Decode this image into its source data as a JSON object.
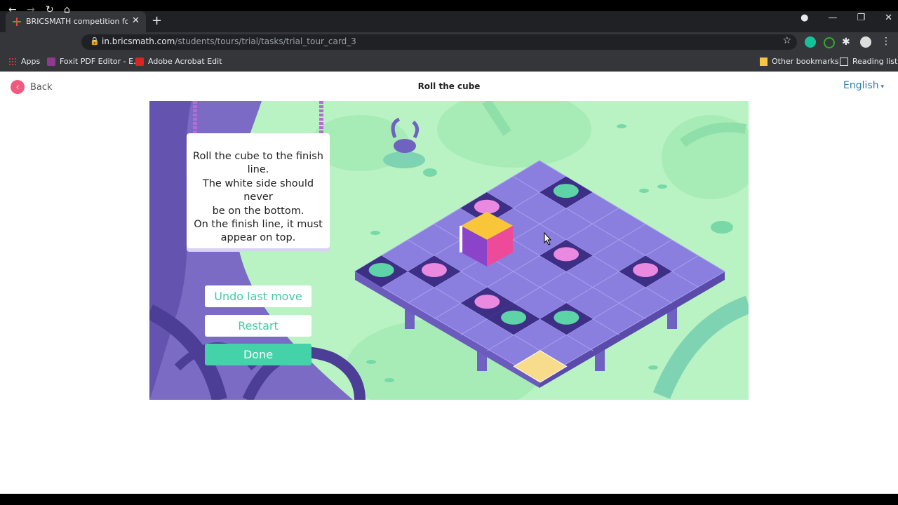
{
  "browser": {
    "tab_title": "BRICSMATH competition for stud",
    "url_host": "in.bricsmath.com",
    "url_path": "/students/tours/trial/tasks/trial_tour_card_3",
    "bookmarks": {
      "apps": "Apps",
      "foxit": "Foxit PDF Editor - E...",
      "acrobat": "Adobe Acrobat Edit",
      "other": "Other bookmarks",
      "reading": "Reading list"
    }
  },
  "page": {
    "back_label": "Back",
    "title": "Roll the cube",
    "language": "English"
  },
  "game": {
    "instruction_lines": [
      "Roll the cube to the finish",
      "line.",
      "The white side should never",
      "be on the bottom.",
      "On the finish line, it must",
      "appear on top."
    ],
    "undo_label": "Undo last move",
    "restart_label": "Restart",
    "done_label": "Done"
  }
}
